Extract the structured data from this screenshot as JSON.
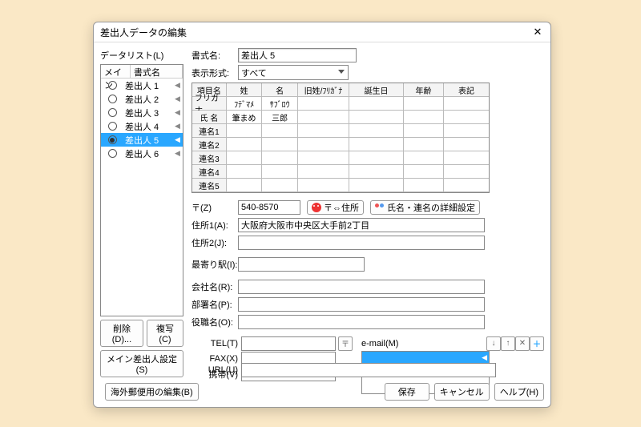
{
  "window": {
    "title": "差出人データの編集"
  },
  "left": {
    "label": "データリスト(L)",
    "head_main": "メイン",
    "head_name": "書式名",
    "items": [
      {
        "label": "差出人 1",
        "sel": false
      },
      {
        "label": "差出人 2",
        "sel": false
      },
      {
        "label": "差出人 3",
        "sel": false
      },
      {
        "label": "差出人 4",
        "sel": false
      },
      {
        "label": "差出人 5",
        "sel": true
      },
      {
        "label": "差出人 6",
        "sel": false
      }
    ],
    "delete": "削除(D)...",
    "copy": "複写(C)",
    "main_sender": "メイン差出人設定(S)"
  },
  "form": {
    "style_label": "書式名:",
    "style_value": "差出人 5",
    "display_label": "表示形式:",
    "display_value": "すべて",
    "grid_head": {
      "item": "項目名",
      "sei": "姓",
      "mei": "名",
      "furi": "旧姓/ﾌﾘｶﾞﾅ",
      "bd": "誕生日",
      "age": "年齢",
      "hyo": "表記"
    },
    "grid_rows": [
      {
        "h": "フリガナ",
        "sei": "ﾌﾃﾞﾏﾒ",
        "mei": "ｻﾌﾞﾛｳ"
      },
      {
        "h": "氏 名",
        "sei": "筆まめ",
        "mei": "三郎"
      },
      {
        "h": "連名1"
      },
      {
        "h": "連名2"
      },
      {
        "h": "連名3"
      },
      {
        "h": "連名4"
      },
      {
        "h": "連名5"
      }
    ],
    "zip_label": "〒(Z)",
    "zip_value": "540-8570",
    "zip_addr_btn": "〒⇔住所",
    "name_detail_btn": "氏名・連名の詳細設定",
    "addr1_label": "住所1(A):",
    "addr1_value": "大阪府大阪市中央区大手前2丁目",
    "addr2_label": "住所2(J):",
    "addr2_value": "",
    "station_label": "最寄り駅(I):",
    "station_value": "",
    "company_label": "会社名(R):",
    "company_value": "",
    "dept_label": "部署名(P):",
    "dept_value": "",
    "title_label": "役職名(O):",
    "title_value": "",
    "tel_label": "TEL(T)",
    "tel_value": "",
    "fax_label": "FAX(X)",
    "fax_value": "",
    "mobile_label": "携帯(V)",
    "mobile_value": "",
    "url_label": "URL(U)",
    "url_value": "",
    "email_label": "e-mail(M)"
  },
  "footer": {
    "overseas": "海外郵便用の編集(B)",
    "save": "保存",
    "cancel": "キャンセル",
    "help": "ヘルプ(H)"
  }
}
